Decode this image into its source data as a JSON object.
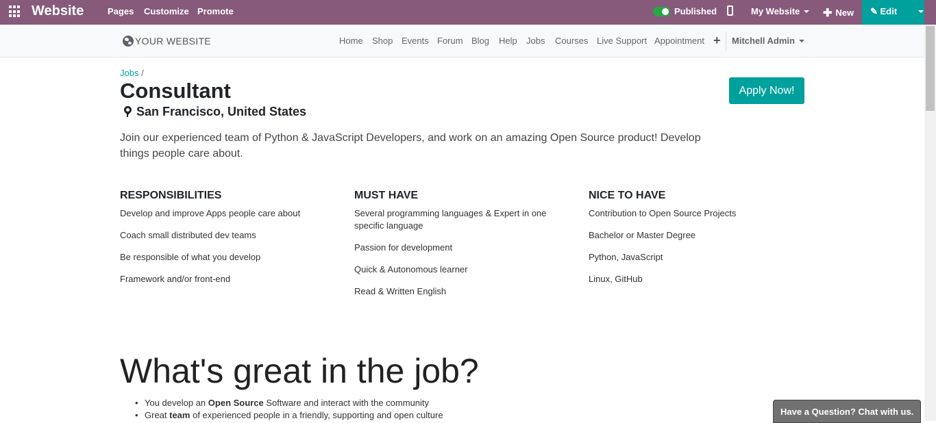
{
  "topbar": {
    "brand": "Website",
    "menu": [
      "Pages",
      "Customize",
      "Promote"
    ],
    "published_label": "Published",
    "my_website_label": "My Website",
    "new_label": "New",
    "edit_label": "Edit",
    "bg_color": "#875a7b",
    "edit_color": "#00a09d",
    "published_on": true
  },
  "sitenav": {
    "logo_text": "YOUR WEBSITE",
    "links": [
      "Home",
      "Shop",
      "Events",
      "Forum",
      "Blog",
      "Help",
      "Jobs",
      "Courses",
      "Live Support",
      "Appointment"
    ],
    "plus": "+",
    "user": "Mitchell Admin"
  },
  "breadcrumb": {
    "link": "Jobs",
    "sep": "/"
  },
  "job": {
    "title": "Consultant",
    "location": "San Francisco, United States",
    "apply_label": "Apply Now!",
    "intro": "Join our experienced team of Python & JavaScript Developers, and work on an amazing Open Source product! Develop things people care about."
  },
  "columns": [
    {
      "heading": "RESPONSIBILITIES",
      "items": [
        "Develop and improve Apps people care about",
        "Coach small distributed dev teams",
        "Be responsible of what you develop",
        "Framework and/or front-end"
      ]
    },
    {
      "heading": "MUST HAVE",
      "items": [
        "Several programming languages & Expert in one specific language",
        "Passion for development",
        "Quick & Autonomous learner",
        "Read & Written English"
      ]
    },
    {
      "heading": "NICE TO HAVE",
      "items": [
        "Contribution to Open Source Projects",
        "Bachelor or Master Degree",
        "Python, JavaScript",
        "Linux, GitHub"
      ]
    }
  ],
  "great": {
    "heading": "What's great in the job?",
    "bullets": [
      {
        "pre": "You develop an ",
        "bold": "Open Source",
        "post": " Software and interact with the community"
      },
      {
        "pre": "Great ",
        "bold": "team",
        "post": " of experienced people in a friendly, supporting and open culture"
      }
    ]
  },
  "chat": {
    "label": "Have a Question? Chat with us."
  }
}
